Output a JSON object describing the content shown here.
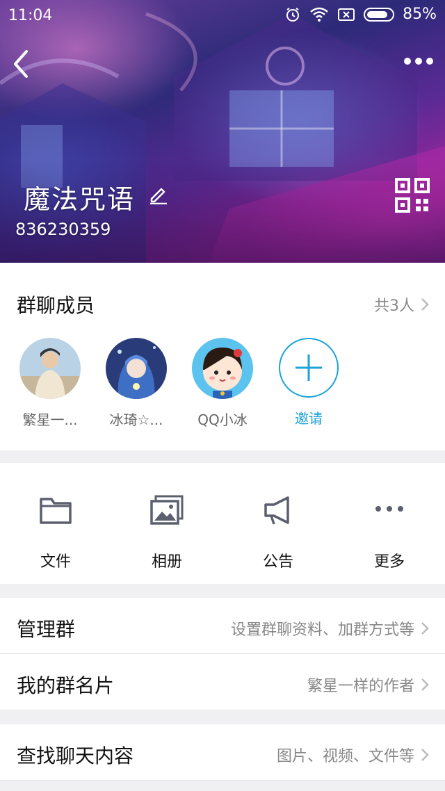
{
  "status_bar": {
    "time": "11:04",
    "battery": "85%",
    "battery_level": 0.85
  },
  "header": {
    "group_name": "魔法咒语",
    "group_number": "836230359"
  },
  "members": {
    "title": "群聊成员",
    "count_label": "共3人",
    "list": [
      {
        "name": "繁星一..."
      },
      {
        "name": "冰琦☆..."
      },
      {
        "name": "QQ小冰"
      }
    ],
    "invite_label": "邀请"
  },
  "tools": [
    {
      "label": "文件",
      "icon": "folder-icon"
    },
    {
      "label": "相册",
      "icon": "album-icon"
    },
    {
      "label": "公告",
      "icon": "megaphone-icon"
    },
    {
      "label": "更多",
      "icon": "more-dots-icon"
    }
  ],
  "settings": {
    "manage": {
      "label": "管理群",
      "value": "设置群聊资料、加群方式等"
    },
    "card": {
      "label": "我的群名片",
      "value": "繁星一样的作者"
    },
    "search": {
      "label": "查找聊天内容",
      "value": "图片、视频、文件等"
    }
  },
  "colors": {
    "accent": "#1aa3d9",
    "muted_text": "#888888",
    "background": "#f0f0f3"
  }
}
